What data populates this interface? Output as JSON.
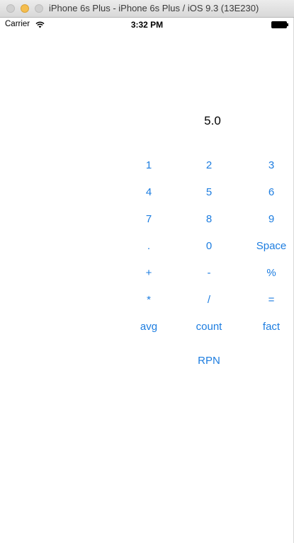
{
  "window": {
    "title": "iPhone 6s Plus - iPhone 6s Plus / iOS 9.3 (13E230)"
  },
  "statusbar": {
    "carrier": "Carrier",
    "time": "3:32 PM",
    "wifi_icon": "wifi-icon",
    "battery_icon": "battery-icon"
  },
  "calculator": {
    "display": "5.0",
    "keys": {
      "one": "1",
      "two": "2",
      "three": "3",
      "four": "4",
      "five": "5",
      "six": "6",
      "seven": "7",
      "eight": "8",
      "nine": "9",
      "dot": ".",
      "zero": "0",
      "space": "Space",
      "plus": "+",
      "minus": "-",
      "percent": "%",
      "multiply": "*",
      "divide": "/",
      "equals": "=",
      "avg": "avg",
      "count": "count",
      "fact": "fact",
      "rpn": "RPN"
    }
  },
  "colors": {
    "key_text": "#1d7de0",
    "display_text": "#000000",
    "background": "#ffffff"
  }
}
